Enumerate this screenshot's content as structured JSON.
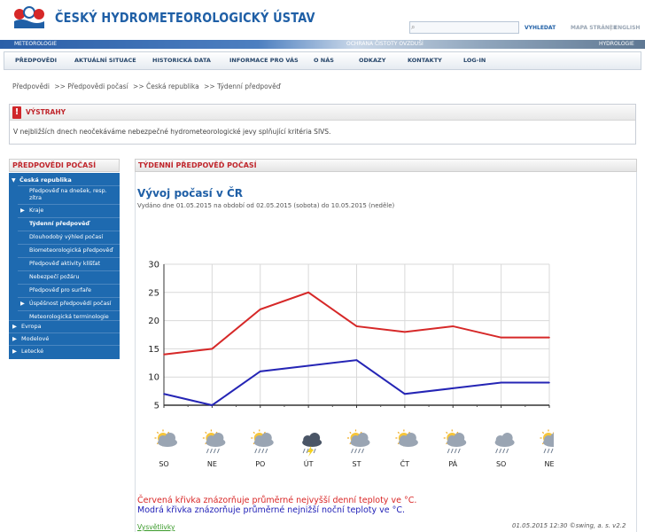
{
  "header": {
    "site_title": "ČESKÝ HYDROMETEOROLOGICKÝ ÚSTAV",
    "search_placeholder": "",
    "search_label": "VYHLEDAT",
    "site_map_label": "MAPA STRÁNEK",
    "separator": "|",
    "english_label": "ENGLISH"
  },
  "banner": {
    "left": "METEOROLOGIE",
    "middle": "OCHRANA ČISTOTY OVZDUŠÍ",
    "right": "HYDROLOGIE"
  },
  "nav": {
    "items": [
      {
        "label": "PŘEDPOVĚDI"
      },
      {
        "label": "AKTUÁLNÍ SITUACE"
      },
      {
        "label": "HISTORICKÁ DATA"
      },
      {
        "label": "INFORMACE PRO VÁS"
      },
      {
        "label": "O NÁS"
      },
      {
        "label": "ODKAZY"
      },
      {
        "label": "KONTAKTY"
      },
      {
        "label": "LOG-IN"
      }
    ]
  },
  "breadcrumb": {
    "items": [
      "Předpovědi",
      ">> Předpovědi počasí",
      ">> Česká republika",
      ">> Týdenní předpověď"
    ]
  },
  "warnings": {
    "title": "VÝSTRAHY",
    "icon": "!",
    "text": "V nejbližších dnech neočekáváme nebezpečné hydrometeorologické jevy splňující kritéria SIVS."
  },
  "sidebar": {
    "title": "PŘEDPOVĚDI POČASÍ",
    "top": "Česká republika",
    "sub_items": [
      {
        "label": "Předpověď na dnešek, resp. zítra",
        "arrow": ""
      },
      {
        "label": "Kraje",
        "arrow": "▶"
      },
      {
        "label": "Týdenní předpověď",
        "arrow": ""
      },
      {
        "label": "Dlouhodobý výhled počasí",
        "arrow": ""
      },
      {
        "label": "Biometeorologická předpověď",
        "arrow": ""
      },
      {
        "label": "Předpověď aktivity klíšťat",
        "arrow": ""
      },
      {
        "label": "Nebezpečí požáru",
        "arrow": ""
      },
      {
        "label": "Předpověď pro surfaře",
        "arrow": ""
      },
      {
        "label": "Úspěšnost předpovědí počasí",
        "arrow": "▶"
      },
      {
        "label": "Meteorologická terminologie",
        "arrow": ""
      }
    ],
    "bottom": [
      {
        "label": "Evropa"
      },
      {
        "label": "Modelové"
      },
      {
        "label": "Letecké"
      }
    ]
  },
  "content": {
    "title": "TÝDENNÍ PŘEDPOVĚĎ POČASÍ",
    "heading": "Vývoj počasí v ČR",
    "issued": "Vydáno dne 01.05.2015 na období od 02.05.2015 (sobota) do 10.05.2015 (neděle)",
    "legend_red": "Červená křivka znázorňuje průměrné nejvyšší denní teploty ve °C.",
    "legend_blue": "Modrá křivka znázorňuje průměrné nejnižší noční teploty ve °C.",
    "explain_link": "Vysvětlivky",
    "footer": "01.05.2015 12:30 ©swing, a. s. v2.2"
  },
  "colors": {
    "accent_blue": "#1f5fa6",
    "accent_red": "#c0272d",
    "max_line": "#d62828",
    "min_line": "#2525b5"
  },
  "chart_data": {
    "type": "line",
    "categories": [
      "SO",
      "NE",
      "PO",
      "ÚT",
      "ST",
      "ČT",
      "PÁ",
      "SO",
      "NE"
    ],
    "series": [
      {
        "values": [
          14,
          15,
          22,
          25,
          19,
          18,
          19,
          17,
          17
        ],
        "color": "#d62828"
      },
      {
        "values": [
          7,
          5,
          11,
          12,
          13,
          7,
          8,
          9,
          9
        ],
        "color": "#2525b5"
      }
    ],
    "yticks": [
      5,
      10,
      15,
      20,
      25,
      30
    ],
    "ylim": [
      5,
      30
    ],
    "grid": true,
    "weather_icons": [
      "partly-cloudy-icon",
      "cloud-rain-sun-icon",
      "cloud-rain-sun-icon",
      "storm-icon",
      "cloud-rain-sun-icon",
      "partly-cloudy-icon",
      "cloud-rain-sun-icon",
      "cloud-rain-icon",
      "cloud-rain-sun-icon"
    ]
  }
}
